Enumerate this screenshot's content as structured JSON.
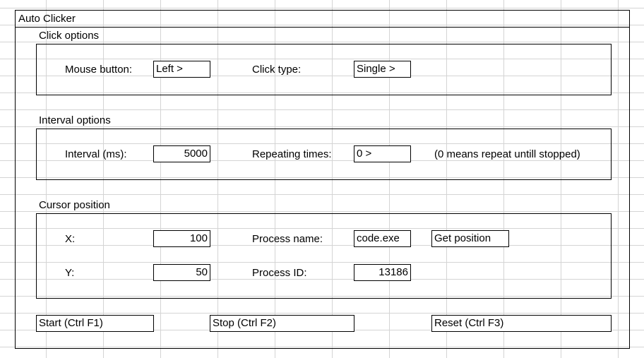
{
  "window": {
    "title": "Auto Clicker"
  },
  "click_options": {
    "heading": "Click options",
    "mouse_button_label": "Mouse button:",
    "mouse_button_value": "Left >",
    "click_type_label": "Click type:",
    "click_type_value": "Single >"
  },
  "interval_options": {
    "heading": "Interval options",
    "interval_label": "Interval (ms):",
    "interval_value": "5000",
    "repeat_label": "Repeating times:",
    "repeat_value": "0 >",
    "repeat_note": "(0 means repeat untill stopped)"
  },
  "cursor_position": {
    "heading": "Cursor position",
    "x_label": "X:",
    "x_value": "100",
    "y_label": "Y:",
    "y_value": "50",
    "process_name_label": "Process name:",
    "process_name_value": "code.exe",
    "process_id_label": "Process ID:",
    "process_id_value": "13186",
    "get_position_label": "Get position"
  },
  "actions": {
    "start_label": "Start (Ctrl F1)",
    "stop_label": "Stop (Ctrl F2)",
    "reset_label": "Reset (Ctrl F3)"
  }
}
